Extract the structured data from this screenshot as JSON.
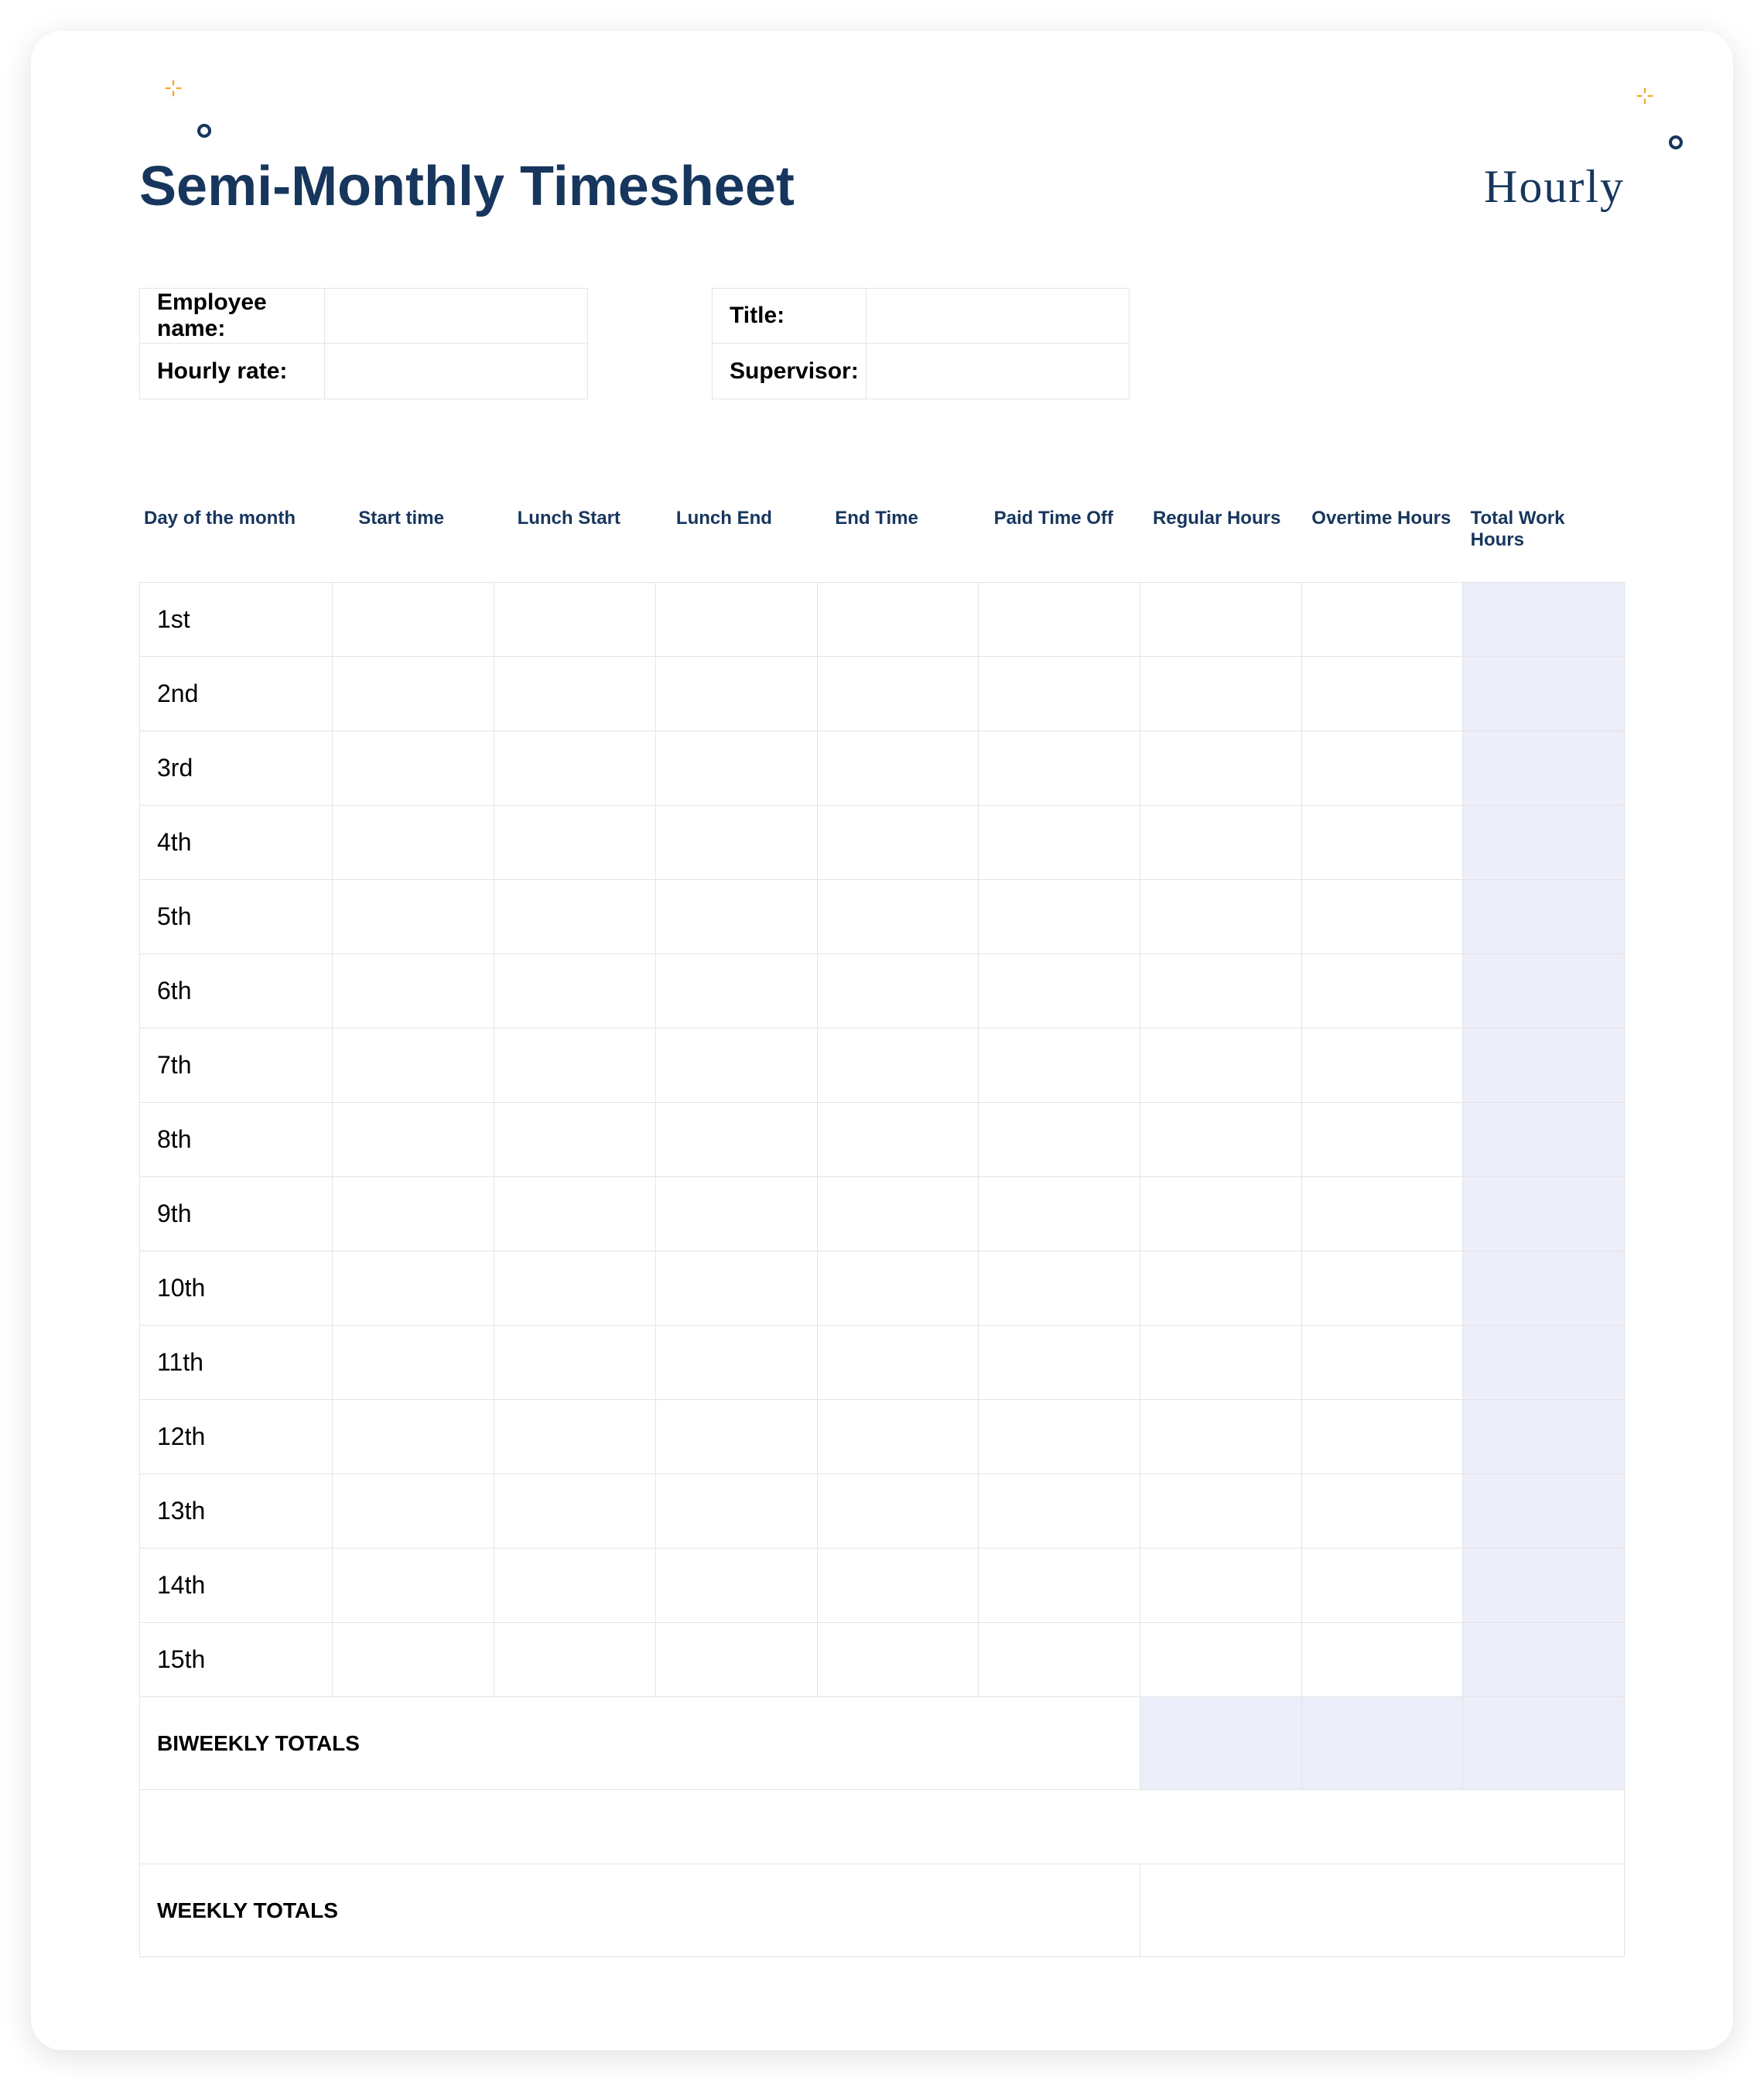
{
  "brand": "Hourly",
  "title": "Semi-Monthly Timesheet",
  "info": {
    "employee_name_label": "Employee name:",
    "employee_name": "",
    "hourly_rate_label": "Hourly rate:",
    "hourly_rate": "",
    "title_label": "Title:",
    "job_title": "",
    "supervisor_label": "Supervisor:",
    "supervisor": ""
  },
  "columns": [
    "Day of the month",
    "Start time",
    "Lunch Start",
    "Lunch End",
    "End Time",
    "Paid Time Off",
    "Regular Hours",
    "Overtime Hours",
    "Total Work Hours"
  ],
  "rows": [
    {
      "day": "1st",
      "start": "",
      "lunch_start": "",
      "lunch_end": "",
      "end": "",
      "pto": "",
      "reg": "",
      "ot": "",
      "total": ""
    },
    {
      "day": "2nd",
      "start": "",
      "lunch_start": "",
      "lunch_end": "",
      "end": "",
      "pto": "",
      "reg": "",
      "ot": "",
      "total": ""
    },
    {
      "day": "3rd",
      "start": "",
      "lunch_start": "",
      "lunch_end": "",
      "end": "",
      "pto": "",
      "reg": "",
      "ot": "",
      "total": ""
    },
    {
      "day": "4th",
      "start": "",
      "lunch_start": "",
      "lunch_end": "",
      "end": "",
      "pto": "",
      "reg": "",
      "ot": "",
      "total": ""
    },
    {
      "day": "5th",
      "start": "",
      "lunch_start": "",
      "lunch_end": "",
      "end": "",
      "pto": "",
      "reg": "",
      "ot": "",
      "total": ""
    },
    {
      "day": "6th",
      "start": "",
      "lunch_start": "",
      "lunch_end": "",
      "end": "",
      "pto": "",
      "reg": "",
      "ot": "",
      "total": ""
    },
    {
      "day": "7th",
      "start": "",
      "lunch_start": "",
      "lunch_end": "",
      "end": "",
      "pto": "",
      "reg": "",
      "ot": "",
      "total": ""
    },
    {
      "day": "8th",
      "start": "",
      "lunch_start": "",
      "lunch_end": "",
      "end": "",
      "pto": "",
      "reg": "",
      "ot": "",
      "total": ""
    },
    {
      "day": "9th",
      "start": "",
      "lunch_start": "",
      "lunch_end": "",
      "end": "",
      "pto": "",
      "reg": "",
      "ot": "",
      "total": ""
    },
    {
      "day": "10th",
      "start": "",
      "lunch_start": "",
      "lunch_end": "",
      "end": "",
      "pto": "",
      "reg": "",
      "ot": "",
      "total": ""
    },
    {
      "day": "11th",
      "start": "",
      "lunch_start": "",
      "lunch_end": "",
      "end": "",
      "pto": "",
      "reg": "",
      "ot": "",
      "total": ""
    },
    {
      "day": "12th",
      "start": "",
      "lunch_start": "",
      "lunch_end": "",
      "end": "",
      "pto": "",
      "reg": "",
      "ot": "",
      "total": ""
    },
    {
      "day": "13th",
      "start": "",
      "lunch_start": "",
      "lunch_end": "",
      "end": "",
      "pto": "",
      "reg": "",
      "ot": "",
      "total": ""
    },
    {
      "day": "14th",
      "start": "",
      "lunch_start": "",
      "lunch_end": "",
      "end": "",
      "pto": "",
      "reg": "",
      "ot": "",
      "total": ""
    },
    {
      "day": "15th",
      "start": "",
      "lunch_start": "",
      "lunch_end": "",
      "end": "",
      "pto": "",
      "reg": "",
      "ot": "",
      "total": ""
    }
  ],
  "biweekly_label": "BIWEEKLY TOTALS",
  "biweekly": {
    "reg": "",
    "ot": "",
    "total": ""
  },
  "weekly_label": "WEEKLY TOTALS",
  "weekly": {
    "total": ""
  }
}
